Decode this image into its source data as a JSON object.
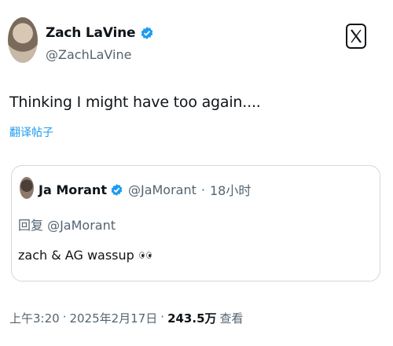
{
  "author": {
    "name": "Zach LaVine",
    "handle": "@ZachLaVine"
  },
  "tweet": {
    "text": "Thinking I might have too again....",
    "translate_label": "翻译帖子"
  },
  "quoted": {
    "name": "Ja Morant",
    "handle": "@JaMorant",
    "separator": "·",
    "time": "18小时",
    "reply_to": "回复 @JaMorant",
    "text": "zach & AG wassup",
    "emoji_icon": "eyes-icon"
  },
  "footer": {
    "time": "上午3:20",
    "dot1": "·",
    "date": "2025年2月17日",
    "dot2": "·",
    "views": "243.5万",
    "views_label": "查看"
  },
  "colors": {
    "verified": "#1d9bf0",
    "link": "#1d9bf0",
    "secondary": "#536471"
  }
}
